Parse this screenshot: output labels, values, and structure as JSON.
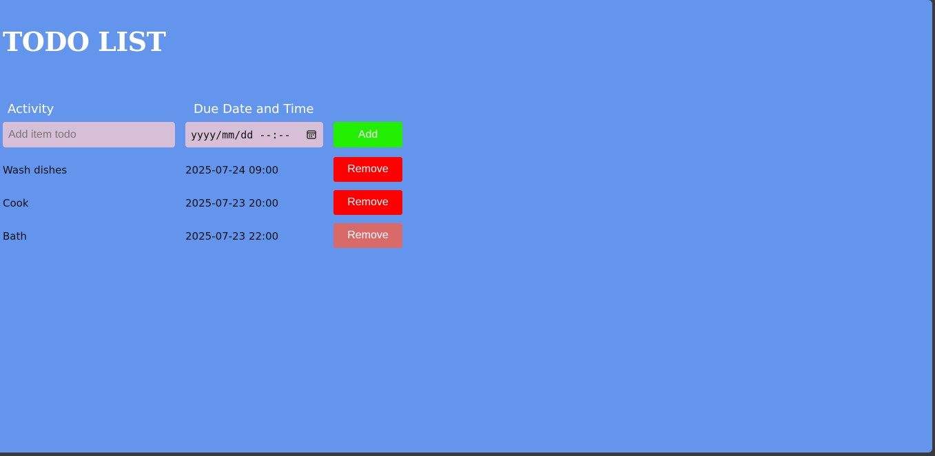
{
  "title": "TODO LIST",
  "headers": {
    "activity": "Activity",
    "due": "Due Date and Time"
  },
  "form": {
    "activity_placeholder": "Add item todo",
    "date_placeholder": "yyyy/mm/dd --:--",
    "add_label": "Add"
  },
  "todos": [
    {
      "activity": "Wash dishes",
      "due": "2025-07-24 09:00",
      "remove_label": "Remove"
    },
    {
      "activity": "Cook",
      "due": "2025-07-23 20:00",
      "remove_label": "Remove"
    },
    {
      "activity": "Bath",
      "due": "2025-07-23 22:00",
      "remove_label": "Remove"
    }
  ],
  "colors": {
    "background": "#6495ed",
    "input_bg": "#d8bfd8",
    "add_button": "#22ee00",
    "remove_button": "#ff0000",
    "remove_button_hover": "#d96a6a"
  }
}
